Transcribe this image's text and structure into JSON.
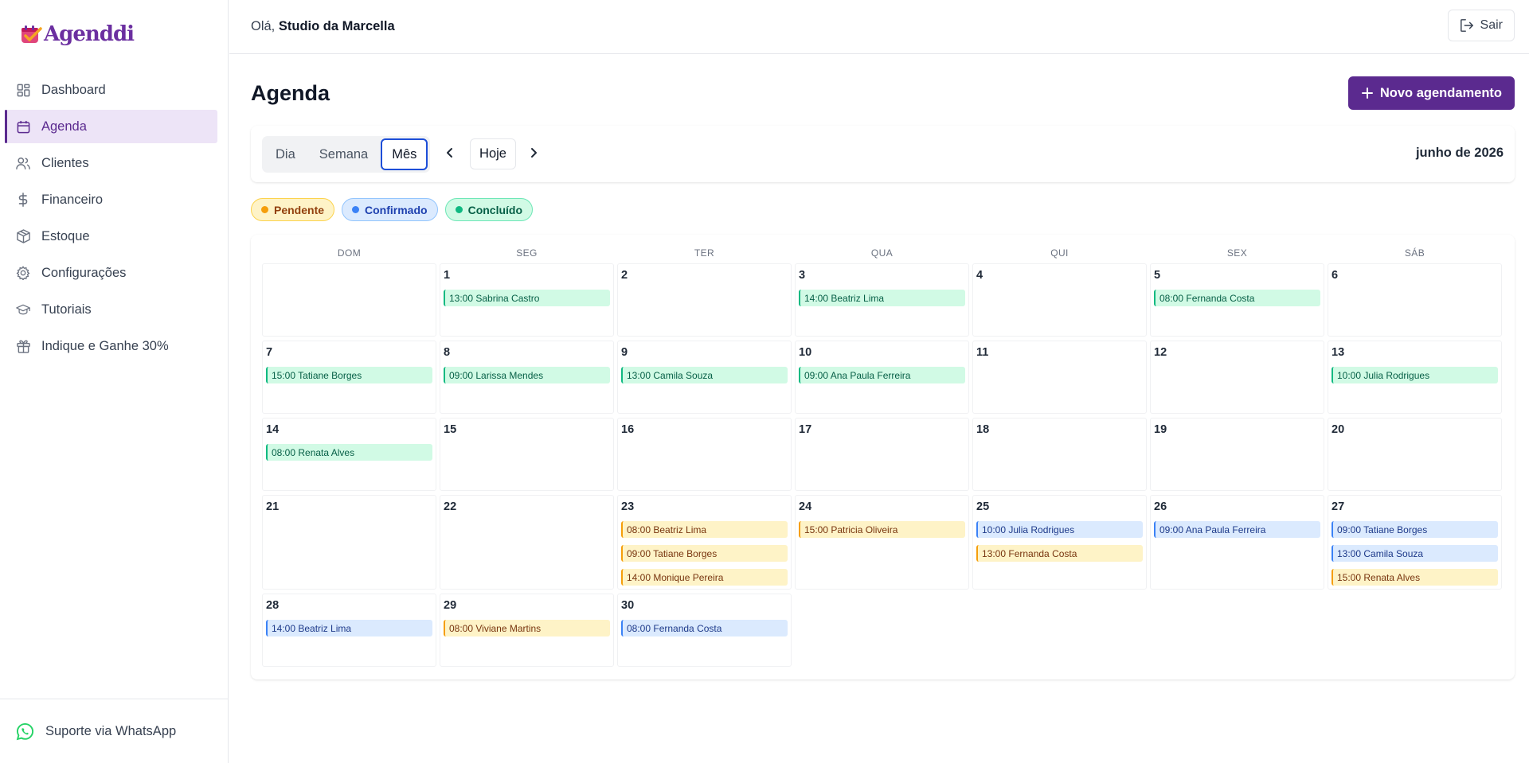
{
  "app": {
    "name": "Agenddi"
  },
  "sidebar": {
    "items": [
      {
        "label": "Dashboard",
        "icon": "dashboard-icon"
      },
      {
        "label": "Agenda",
        "icon": "calendar-icon",
        "active": true
      },
      {
        "label": "Clientes",
        "icon": "users-icon"
      },
      {
        "label": "Financeiro",
        "icon": "dollar-icon"
      },
      {
        "label": "Estoque",
        "icon": "box-icon"
      },
      {
        "label": "Configurações",
        "icon": "gear-icon"
      },
      {
        "label": "Tutoriais",
        "icon": "graduation-cap-icon"
      },
      {
        "label": "Indique e Ganhe 30%",
        "icon": "gift-icon"
      }
    ],
    "footer": {
      "label": "Suporte via WhatsApp",
      "icon": "whatsapp-icon"
    }
  },
  "header": {
    "greeting_prefix": "Olá, ",
    "user": "Studio da Marcella",
    "logout_label": "Sair"
  },
  "page": {
    "title": "Agenda",
    "new_button": "Novo agendamento"
  },
  "toolbar": {
    "views": [
      {
        "label": "Dia",
        "active": false
      },
      {
        "label": "Semana",
        "active": false
      },
      {
        "label": "Mês",
        "active": true
      }
    ],
    "today_label": "Hoje",
    "month_label": "junho de 2026"
  },
  "legend": [
    {
      "label": "Pendente",
      "status": "pendente"
    },
    {
      "label": "Confirmado",
      "status": "confirmado"
    },
    {
      "label": "Concluído",
      "status": "concluido"
    }
  ],
  "colors": {
    "brand": "#5b2a8f",
    "pendente": "#f59e0b",
    "confirmado": "#3b82f6",
    "concluido": "#10b981"
  },
  "calendar": {
    "weekdays": [
      "DOM",
      "SEG",
      "TER",
      "QUA",
      "QUI",
      "SEX",
      "SÁB"
    ],
    "weeks": [
      [
        null,
        {
          "day": "1",
          "events": [
            {
              "label": "13:00 Sabrina Castro",
              "status": "concluido"
            }
          ]
        },
        {
          "day": "2",
          "events": []
        },
        {
          "day": "3",
          "events": [
            {
              "label": "14:00 Beatriz Lima",
              "status": "concluido"
            }
          ]
        },
        {
          "day": "4",
          "events": []
        },
        {
          "day": "5",
          "events": [
            {
              "label": "08:00 Fernanda Costa",
              "status": "concluido"
            }
          ]
        },
        {
          "day": "6",
          "events": []
        }
      ],
      [
        {
          "day": "7",
          "events": [
            {
              "label": "15:00 Tatiane Borges",
              "status": "concluido"
            }
          ]
        },
        {
          "day": "8",
          "events": [
            {
              "label": "09:00 Larissa Mendes",
              "status": "concluido"
            }
          ]
        },
        {
          "day": "9",
          "events": [
            {
              "label": "13:00 Camila Souza",
              "status": "concluido"
            }
          ]
        },
        {
          "day": "10",
          "events": [
            {
              "label": "09:00 Ana Paula Ferreira",
              "status": "concluido"
            }
          ]
        },
        {
          "day": "11",
          "events": []
        },
        {
          "day": "12",
          "events": []
        },
        {
          "day": "13",
          "events": [
            {
              "label": "10:00 Julia Rodrigues",
              "status": "concluido"
            }
          ]
        }
      ],
      [
        {
          "day": "14",
          "events": [
            {
              "label": "08:00 Renata Alves",
              "status": "concluido"
            }
          ]
        },
        {
          "day": "15",
          "events": []
        },
        {
          "day": "16",
          "events": []
        },
        {
          "day": "17",
          "events": []
        },
        {
          "day": "18",
          "events": []
        },
        {
          "day": "19",
          "events": []
        },
        {
          "day": "20",
          "events": []
        }
      ],
      [
        {
          "day": "21",
          "events": []
        },
        {
          "day": "22",
          "events": []
        },
        {
          "day": "23",
          "events": [
            {
              "label": "08:00 Beatriz Lima",
              "status": "pendente"
            },
            {
              "label": "09:00 Tatiane Borges",
              "status": "pendente"
            },
            {
              "label": "14:00 Monique Pereira",
              "status": "pendente"
            }
          ]
        },
        {
          "day": "24",
          "events": [
            {
              "label": "15:00 Patricia Oliveira",
              "status": "pendente"
            }
          ]
        },
        {
          "day": "25",
          "events": [
            {
              "label": "10:00 Julia Rodrigues",
              "status": "confirmado"
            },
            {
              "label": "13:00 Fernanda Costa",
              "status": "pendente"
            }
          ]
        },
        {
          "day": "26",
          "events": [
            {
              "label": "09:00 Ana Paula Ferreira",
              "status": "confirmado"
            }
          ]
        },
        {
          "day": "27",
          "events": [
            {
              "label": "09:00 Tatiane Borges",
              "status": "confirmado"
            },
            {
              "label": "13:00 Camila Souza",
              "status": "confirmado"
            },
            {
              "label": "15:00 Renata Alves",
              "status": "pendente"
            }
          ]
        }
      ],
      [
        {
          "day": "28",
          "events": [
            {
              "label": "14:00 Beatriz Lima",
              "status": "confirmado"
            }
          ]
        },
        {
          "day": "29",
          "events": [
            {
              "label": "08:00 Viviane Martins",
              "status": "pendente"
            }
          ]
        },
        {
          "day": "30",
          "events": [
            {
              "label": "08:00 Fernanda Costa",
              "status": "confirmado"
            }
          ]
        },
        null,
        null,
        null,
        null
      ]
    ]
  }
}
